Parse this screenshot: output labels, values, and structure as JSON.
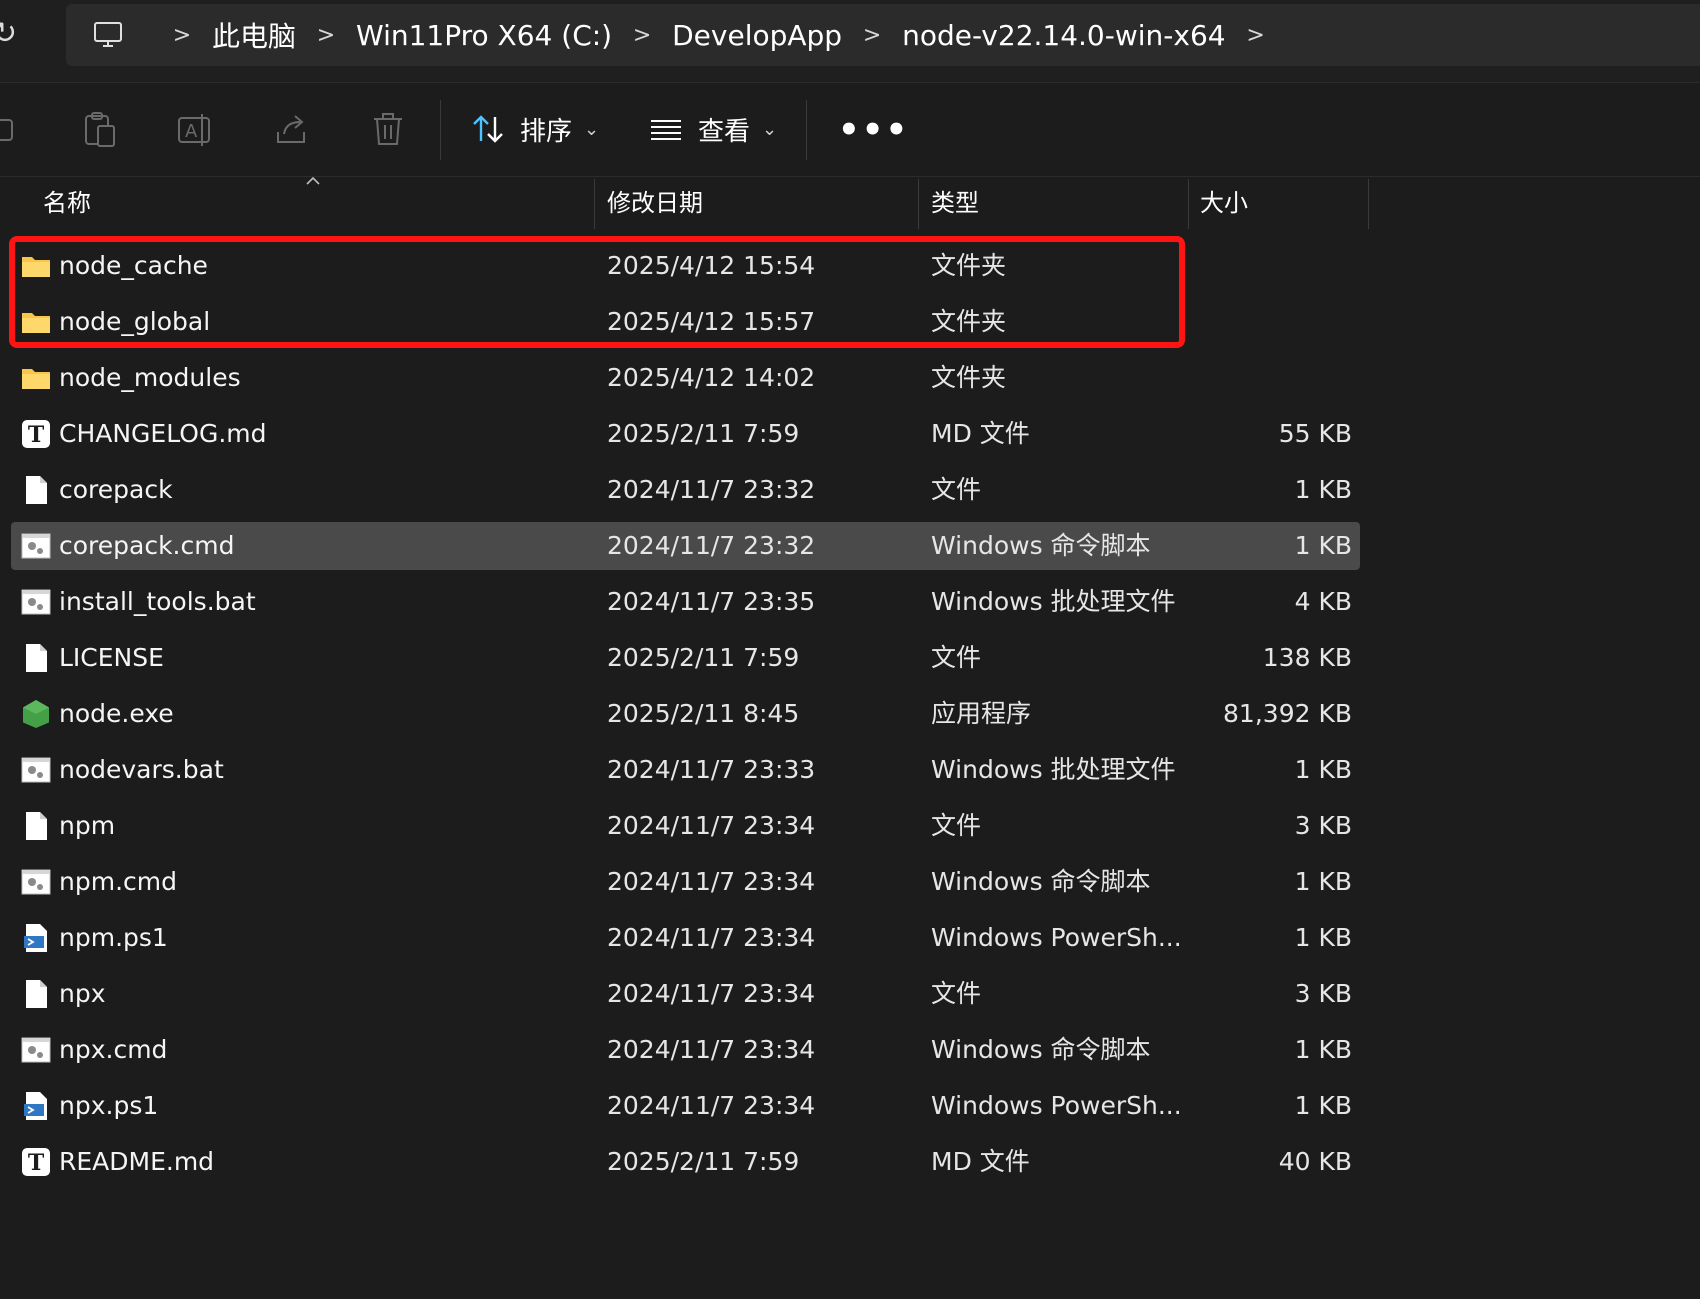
{
  "breadcrumb": {
    "items": [
      "此电脑",
      "Win11Pro X64 (C:)",
      "DevelopApp",
      "node-v22.14.0-win-x64"
    ],
    "separator": ">"
  },
  "toolbar": {
    "sort_label": "排序",
    "view_label": "查看",
    "more_label": "•••",
    "dropdown_glyph": "⌄"
  },
  "columns": {
    "name": "名称",
    "date": "修改日期",
    "type": "类型",
    "size": "大小"
  },
  "files": [
    {
      "name": "node_cache",
      "date": "2025/4/12 15:54",
      "type": "文件夹",
      "size": "",
      "icon": "folder-icon"
    },
    {
      "name": "node_global",
      "date": "2025/4/12 15:57",
      "type": "文件夹",
      "size": "",
      "icon": "folder-icon"
    },
    {
      "name": "node_modules",
      "date": "2025/4/12 14:02",
      "type": "文件夹",
      "size": "",
      "icon": "folder-icon"
    },
    {
      "name": "CHANGELOG.md",
      "date": "2025/2/11 7:59",
      "type": "MD 文件",
      "size": "55 KB",
      "icon": "markdown-file-icon"
    },
    {
      "name": "corepack",
      "date": "2024/11/7 23:32",
      "type": "文件",
      "size": "1 KB",
      "icon": "file-icon"
    },
    {
      "name": "corepack.cmd",
      "date": "2024/11/7 23:32",
      "type": "Windows 命令脚本",
      "size": "1 KB",
      "icon": "script-file-icon",
      "selected": true
    },
    {
      "name": "install_tools.bat",
      "date": "2024/11/7 23:35",
      "type": "Windows 批处理文件",
      "size": "4 KB",
      "icon": "script-file-icon"
    },
    {
      "name": "LICENSE",
      "date": "2025/2/11 7:59",
      "type": "文件",
      "size": "138 KB",
      "icon": "file-icon"
    },
    {
      "name": "node.exe",
      "date": "2025/2/11 8:45",
      "type": "应用程序",
      "size": "81,392 KB",
      "icon": "node-exe-icon"
    },
    {
      "name": "nodevars.bat",
      "date": "2024/11/7 23:33",
      "type": "Windows 批处理文件",
      "size": "1 KB",
      "icon": "script-file-icon"
    },
    {
      "name": "npm",
      "date": "2024/11/7 23:34",
      "type": "文件",
      "size": "3 KB",
      "icon": "file-icon"
    },
    {
      "name": "npm.cmd",
      "date": "2024/11/7 23:34",
      "type": "Windows 命令脚本",
      "size": "1 KB",
      "icon": "script-file-icon"
    },
    {
      "name": "npm.ps1",
      "date": "2024/11/7 23:34",
      "type": "Windows PowerSh...",
      "size": "1 KB",
      "icon": "powershell-file-icon"
    },
    {
      "name": "npx",
      "date": "2024/11/7 23:34",
      "type": "文件",
      "size": "3 KB",
      "icon": "file-icon"
    },
    {
      "name": "npx.cmd",
      "date": "2024/11/7 23:34",
      "type": "Windows 命令脚本",
      "size": "1 KB",
      "icon": "script-file-icon"
    },
    {
      "name": "npx.ps1",
      "date": "2024/11/7 23:34",
      "type": "Windows PowerSh...",
      "size": "1 KB",
      "icon": "powershell-file-icon"
    },
    {
      "name": "README.md",
      "date": "2025/2/11 7:59",
      "type": "MD 文件",
      "size": "40 KB",
      "icon": "markdown-file-icon"
    }
  ],
  "colors": {
    "background": "#1c1c1c",
    "highlight_box": "#ff1414",
    "folder": "#f8c646",
    "node_green": "#43a047",
    "selected_row": "#4a4a4a"
  }
}
